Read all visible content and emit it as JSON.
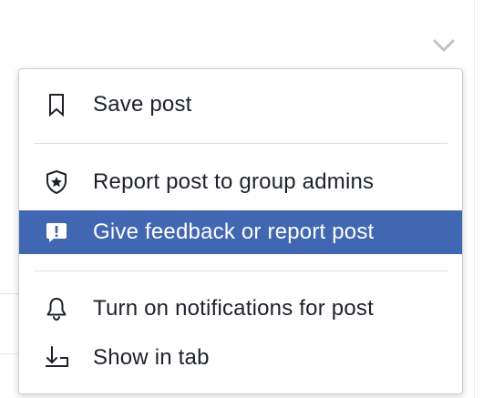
{
  "menu": {
    "items": [
      {
        "label": "Save post",
        "icon": "bookmark-icon"
      },
      {
        "label": "Report post to group admins",
        "icon": "shield-star-icon"
      },
      {
        "label": "Give feedback or report post",
        "icon": "feedback-exclamation-icon",
        "highlighted": true
      },
      {
        "label": "Turn on notifications for post",
        "icon": "bell-icon"
      },
      {
        "label": "Show in tab",
        "icon": "download-tab-icon"
      }
    ]
  },
  "colors": {
    "highlight": "#4267b2",
    "text": "#1d2129",
    "divider": "#dddfe2",
    "chevron": "#bec3c9"
  }
}
